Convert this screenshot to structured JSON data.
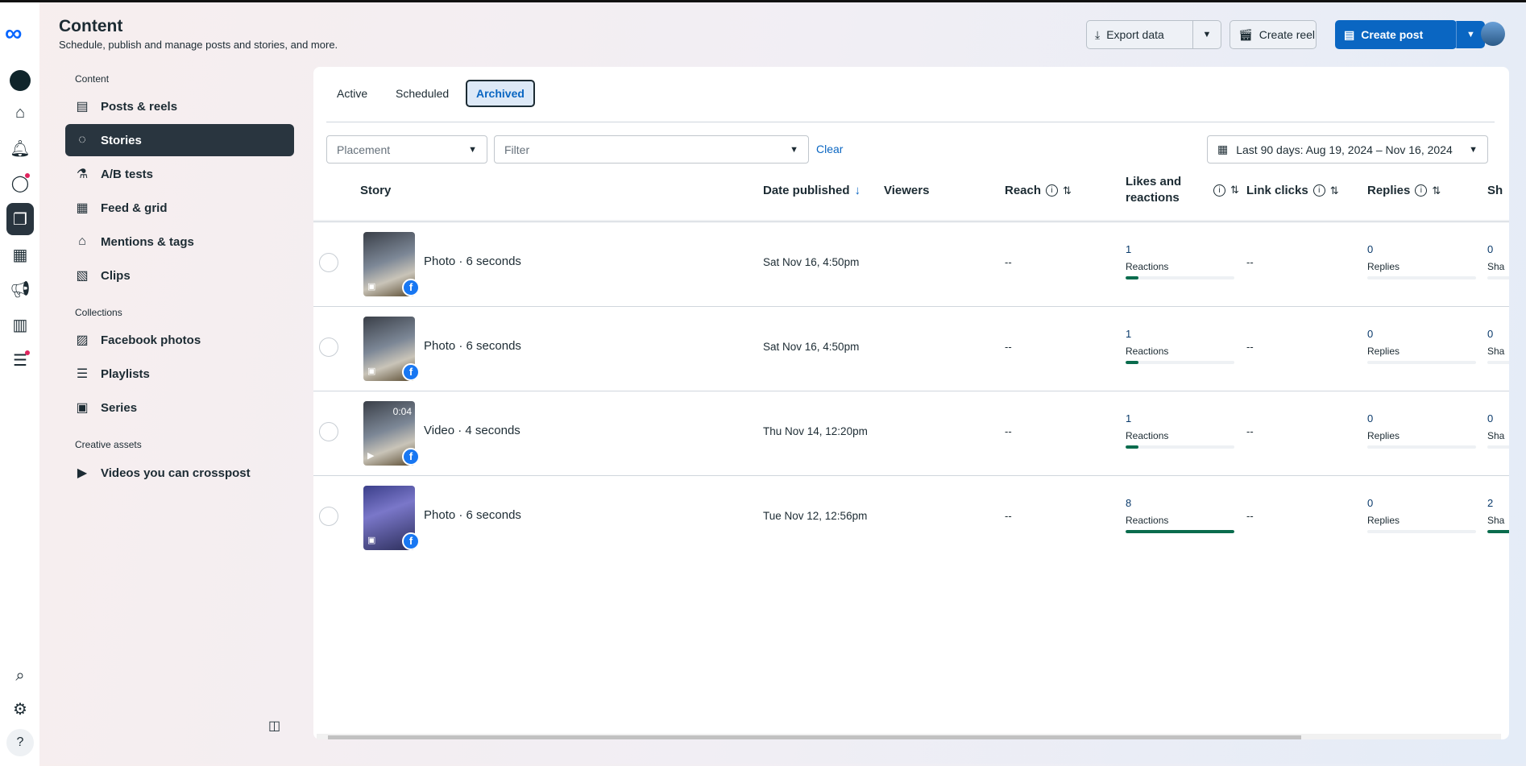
{
  "header": {
    "title": "Content",
    "subtitle": "Schedule, publish and manage posts and stories, and more."
  },
  "toolbar": {
    "export": "Export data",
    "create_reel": "Create reel",
    "create_post": "Create post"
  },
  "nav": {
    "sections": [
      "Content",
      "Collections",
      "Creative assets"
    ],
    "items": [
      {
        "label": "Posts & reels",
        "icon": "post-icon",
        "glyph": "▤"
      },
      {
        "label": "Stories",
        "icon": "stories-icon",
        "glyph": "◌"
      },
      {
        "label": "A/B tests",
        "icon": "flask-icon",
        "glyph": "⚗"
      },
      {
        "label": "Feed & grid",
        "icon": "feed-icon",
        "glyph": "▦"
      },
      {
        "label": "Mentions & tags",
        "icon": "tag-icon",
        "glyph": "⌂"
      },
      {
        "label": "Clips",
        "icon": "clips-icon",
        "glyph": "▧"
      },
      {
        "label": "Facebook photos",
        "icon": "photos-icon",
        "glyph": "▨"
      },
      {
        "label": "Playlists",
        "icon": "playlist-icon",
        "glyph": "☰"
      },
      {
        "label": "Series",
        "icon": "series-icon",
        "glyph": "▣"
      },
      {
        "label": "Videos you can crosspost",
        "icon": "video-icon",
        "glyph": "▶"
      }
    ]
  },
  "tabs": [
    "Active",
    "Scheduled",
    "Archived"
  ],
  "filters": {
    "placement": "Placement",
    "filter": "Filter",
    "clear": "Clear",
    "date_range": "Last 90 days: Aug 19, 2024 – Nov 16, 2024"
  },
  "columns": {
    "story": "Story",
    "date": "Date published",
    "viewers": "Viewers",
    "reach": "Reach",
    "likes": "Likes and reactions",
    "link_clicks": "Link clicks",
    "replies": "Replies",
    "shares": "Sh"
  },
  "rows": [
    {
      "type": "Photo · 6 seconds",
      "date": "Sat Nov 16, 4:50pm",
      "reach": "--",
      "reactions": "1",
      "reactions_label": "Reactions",
      "reactions_pct": 12,
      "link_clicks": "--",
      "replies": "0",
      "replies_label": "Replies",
      "shares": "0",
      "shares_label": "Sha",
      "shares_pct": 0
    },
    {
      "type": "Photo · 6 seconds",
      "date": "Sat Nov 16, 4:50pm",
      "reach": "--",
      "reactions": "1",
      "reactions_label": "Reactions",
      "reactions_pct": 12,
      "link_clicks": "--",
      "replies": "0",
      "replies_label": "Replies",
      "shares": "0",
      "shares_label": "Sha",
      "shares_pct": 0
    },
    {
      "type": "Video · 4 seconds",
      "duration": "0:04",
      "date": "Thu Nov 14, 12:20pm",
      "reach": "--",
      "reactions": "1",
      "reactions_label": "Reactions",
      "reactions_pct": 12,
      "link_clicks": "--",
      "replies": "0",
      "replies_label": "Replies",
      "shares": "0",
      "shares_label": "Sha",
      "shares_pct": 0
    },
    {
      "type": "Photo · 6 seconds",
      "date": "Tue Nov 12, 12:56pm",
      "reach": "--",
      "reactions": "8",
      "reactions_label": "Reactions",
      "reactions_pct": 100,
      "link_clicks": "--",
      "replies": "0",
      "replies_label": "Replies",
      "shares": "2",
      "shares_label": "Sha",
      "shares_pct": 100
    }
  ],
  "colors": {
    "accent": "#0a66c2",
    "nav_active": "#29353f",
    "bar": "#0a6c4d",
    "facebook": "#1877f2"
  }
}
